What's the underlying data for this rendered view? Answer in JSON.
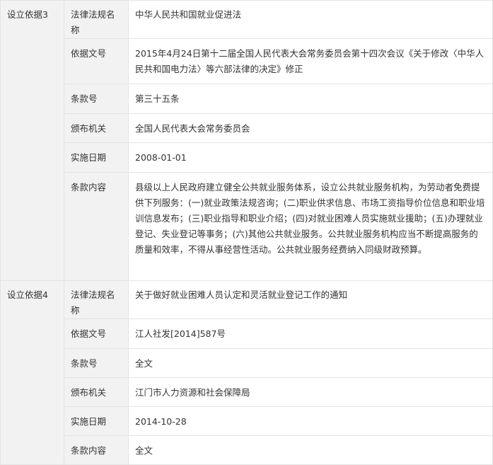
{
  "groups": [
    {
      "label": "设立依据3",
      "rows": [
        {
          "label": "法律法规名称",
          "value": "中华人民共和国就业促进法"
        },
        {
          "label": "依据文号",
          "value": "2015年4月24日第十二届全国人民代表大会常务委员会第十四次会议《关于修改〈中华人民共和国电力法〉等六部法律的决定》修正"
        },
        {
          "label": "条款号",
          "value": "第三十五条"
        },
        {
          "label": "颁布机关",
          "value": "全国人民代表大会常务委员会"
        },
        {
          "label": "实施日期",
          "value": "2008-01-01"
        },
        {
          "label": "条款内容",
          "value": "县级以上人民政府建立健全公共就业服务体系，设立公共就业服务机构，为劳动者免费提供下列服务：(一)就业政策法规咨询；(二)职业供求信息、市场工资指导价位信息和职业培训信息发布；(三)职业指导和职业介绍；(四)对就业困难人员实施就业援助；(五)办理就业登记、失业登记等事务；(六)其他公共就业服务。公共就业服务机构应当不断提高服务的质量和效率，不得从事经营性活动。公共就业服务经费纳入同级财政预算。"
        }
      ]
    },
    {
      "label": "设立依据4",
      "rows": [
        {
          "label": "法律法规名称",
          "value": "关于做好就业困难人员认定和灵活就业登记工作的通知"
        },
        {
          "label": "依据文号",
          "value": "江人社发[2014]587号"
        },
        {
          "label": "条款号",
          "value": "全文"
        },
        {
          "label": "颁布机关",
          "value": "江门市人力资源和社会保障局"
        },
        {
          "label": "实施日期",
          "value": "2014-10-28"
        },
        {
          "label": "条款内容",
          "value": "全文"
        }
      ]
    }
  ]
}
